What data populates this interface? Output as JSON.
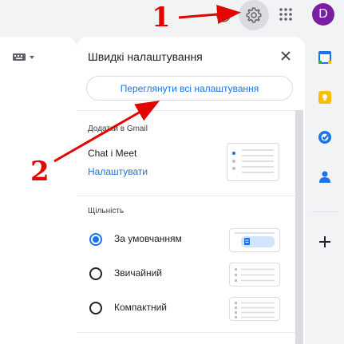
{
  "header": {
    "avatar_letter": "D"
  },
  "panel": {
    "title": "Швидкі налаштування",
    "see_all_button": "Переглянути всі налаштування",
    "addons_section": {
      "label": "Додатки в Gmail",
      "item_title": "Chat і Meet",
      "item_link": "Налаштувати"
    },
    "density_section": {
      "label": "Щільність",
      "options": [
        {
          "label": "За умовчанням",
          "selected": true
        },
        {
          "label": "Звичайний",
          "selected": false
        },
        {
          "label": "Компактний",
          "selected": false
        }
      ]
    }
  },
  "annotations": {
    "one": "1",
    "two": "2"
  },
  "colors": {
    "accent": "#1a73e8",
    "annotation": "#e10600",
    "avatar": "#7b1fa2"
  },
  "icons": [
    "help-icon",
    "settings-gear-icon",
    "apps-grid-icon",
    "keyboard-icon",
    "close-icon",
    "calendar-icon",
    "keep-icon",
    "tasks-icon",
    "contacts-icon",
    "plus-icon"
  ]
}
